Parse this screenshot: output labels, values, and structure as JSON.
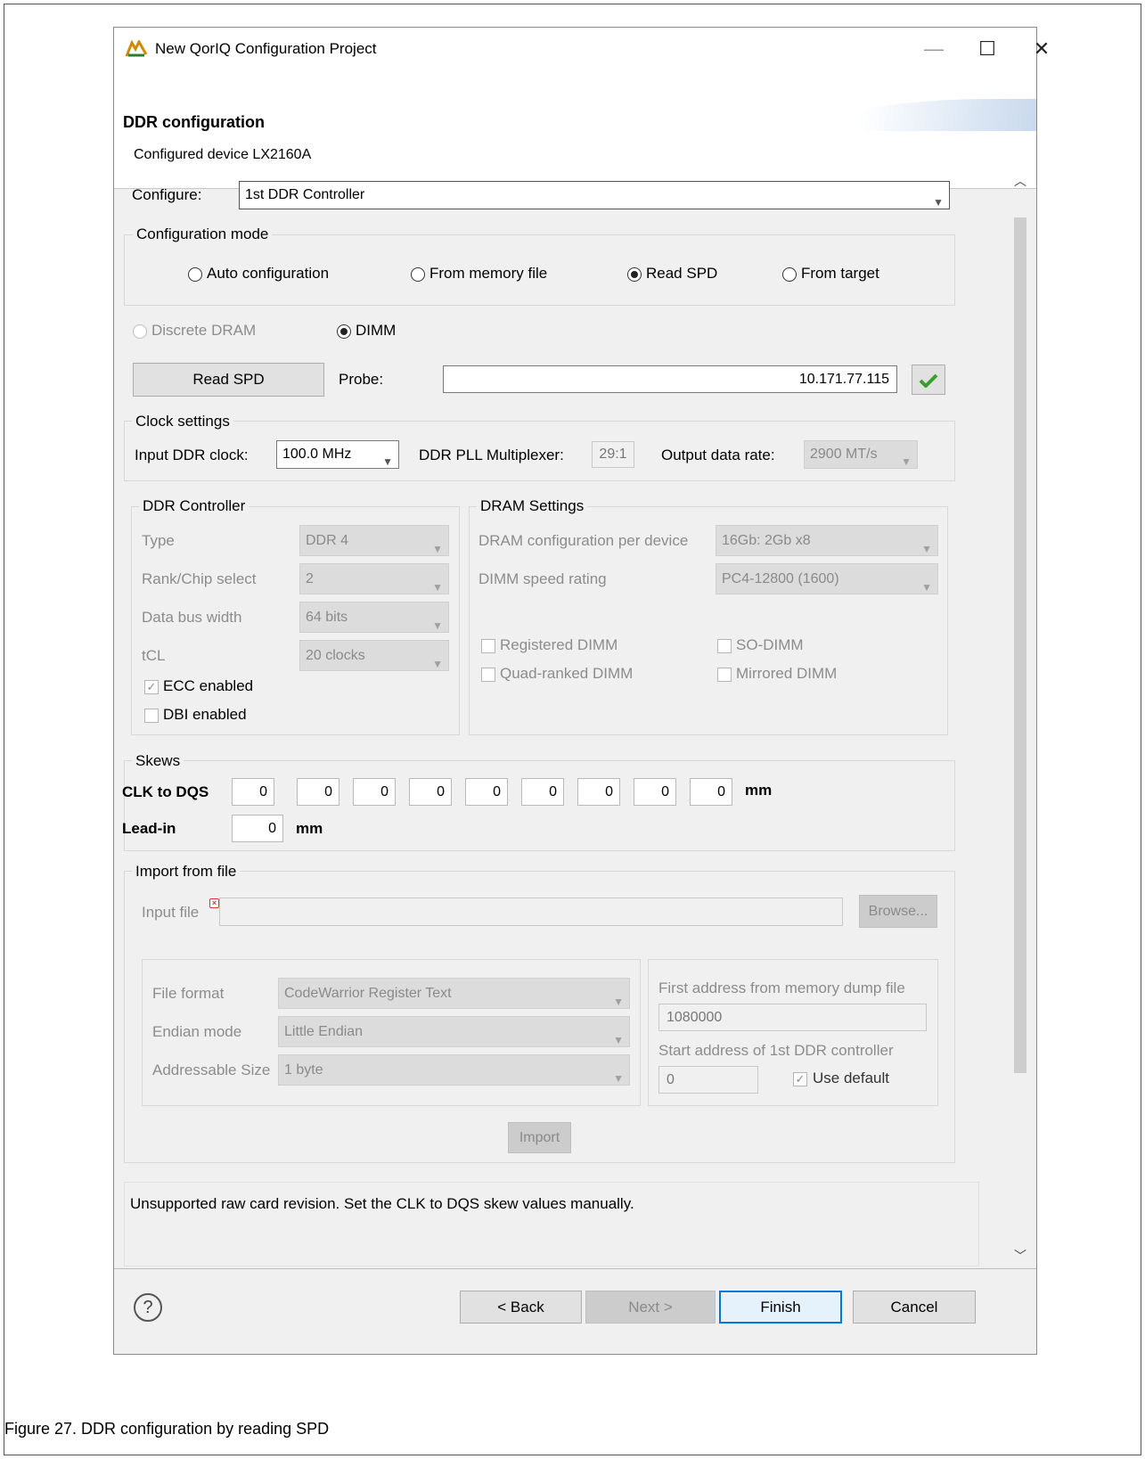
{
  "window": {
    "title": "New QorIQ Configuration Project",
    "minimize_glyph": "—",
    "maximize_glyph": "☐",
    "close_glyph": "✕"
  },
  "banner": {
    "title": "DDR configuration",
    "subtitle": "Configured device LX2160A"
  },
  "configure": {
    "label": "Configure:",
    "value": "1st DDR Controller"
  },
  "configuration_mode": {
    "title": "Configuration mode",
    "options": [
      "Auto configuration",
      "From memory file",
      "Read SPD",
      "From target"
    ],
    "selected": "Read SPD"
  },
  "memory_type": {
    "discrete": "Discrete DRAM",
    "dimm": "DIMM"
  },
  "probe": {
    "button": "Read SPD",
    "label": "Probe:",
    "value": "10.171.77.115",
    "status_icon": "check-icon"
  },
  "clock": {
    "title": "Clock settings",
    "input_label": "Input DDR clock:",
    "input_value": "100.0 MHz",
    "pll_label": "DDR PLL Multiplexer:",
    "pll_value": "29:1",
    "rate_label": "Output data rate:",
    "rate_value": "2900 MT/s"
  },
  "ddr_controller": {
    "title": "DDR Controller",
    "rows": [
      {
        "label": "Type",
        "value": "DDR 4"
      },
      {
        "label": "Rank/Chip select",
        "value": "2"
      },
      {
        "label": "Data bus width",
        "value": "64 bits"
      },
      {
        "label": "tCL",
        "value": "20 clocks"
      }
    ],
    "ecc_label": "ECC enabled",
    "dbi_label": "DBI enabled"
  },
  "dram_settings": {
    "title": "DRAM Settings",
    "config_label": "DRAM configuration per device",
    "config_value": "16Gb: 2Gb x8",
    "speed_label": "DIMM speed rating",
    "speed_value": "PC4-12800 (1600)",
    "checks": [
      "Registered DIMM",
      "SO-DIMM",
      "Quad-ranked DIMM",
      "Mirrored DIMM"
    ]
  },
  "skews": {
    "title": "Skews",
    "clk_label": "CLK to DQS",
    "clk_values": [
      "0",
      "0",
      "0",
      "0",
      "0",
      "0",
      "0",
      "0",
      "0"
    ],
    "unit": "mm",
    "leadin_label": "Lead-in",
    "leadin_value": "0"
  },
  "import_file": {
    "title": "Import from file",
    "input_label": "Input file",
    "browse": "Browse...",
    "format_label": "File format",
    "format_value": "CodeWarrior Register Text",
    "endian_label": "Endian mode",
    "endian_value": "Little Endian",
    "size_label": "Addressable Size",
    "size_value": "1 byte",
    "first_addr_label": "First address from memory dump file",
    "first_addr_value": "1080000",
    "start_addr_label": "Start address of 1st DDR controller",
    "start_addr_value": "0",
    "use_default": "Use default",
    "import_button": "Import"
  },
  "message": "Unsupported raw card revision. Set the CLK to DQS skew values manually.",
  "footer": {
    "help": "?",
    "back": "< Back",
    "next": "Next >",
    "finish": "Finish",
    "cancel": "Cancel"
  },
  "caption": "Figure 27. DDR configuration by reading SPD"
}
